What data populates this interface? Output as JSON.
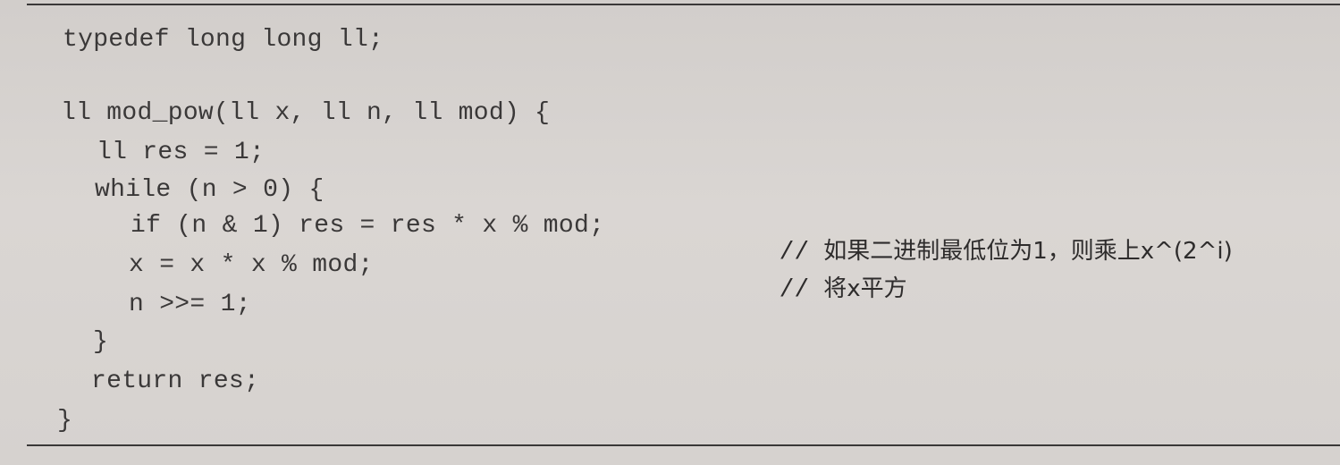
{
  "code": {
    "lines": [
      "typedef long long ll;",
      "ll mod_pow(ll x, ll n, ll mod) {",
      "ll res = 1;",
      "while (n > 0) {",
      "if (n & 1) res = res * x % mod;",
      "x = x * x % mod;",
      "n >>= 1;",
      "}",
      "return res;",
      "}"
    ],
    "comments": [
      {
        "marker": "//",
        "text": "如果二进制最低位为1，则乘上x^(2^i)"
      },
      {
        "marker": "//",
        "text": "将x平方"
      }
    ]
  }
}
